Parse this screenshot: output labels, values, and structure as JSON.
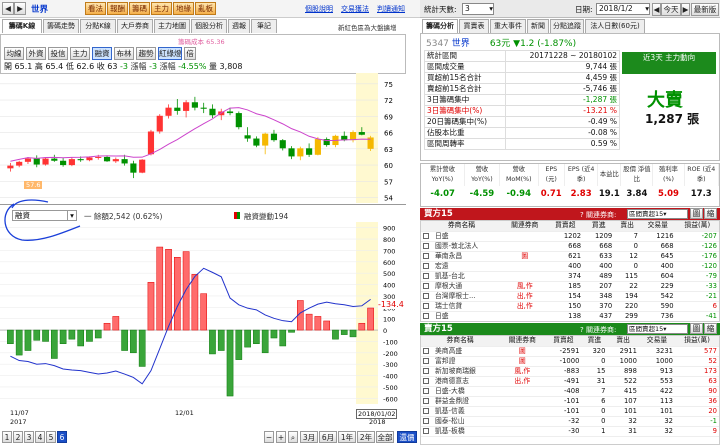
{
  "toolbar": {
    "back": "◀",
    "fwd": "▶",
    "market": "世界",
    "buttons": [
      "看法",
      "報酬",
      "籌碼",
      "主力",
      "地緣",
      "亂板"
    ],
    "links": [
      "個股說明",
      "交易獲法",
      "判讀通知"
    ]
  },
  "tabs": [
    "籌碼K線",
    "籌碼走勢",
    "分點K線",
    "大戶券商",
    "主力地圖",
    "個股分析",
    "週報",
    "筆記"
  ],
  "tabs_right_note": "新紅色區為大盤擴增",
  "chart_title": "籌碼成本 65.36",
  "indicator_buttons": [
    "均線",
    "外資",
    "投信",
    "主力",
    "融資",
    "布林",
    "趨勢",
    "紅綠燈",
    "倍"
  ],
  "ohlc": {
    "open": "開 65.1",
    "high": "高 65.4",
    "low": "低 62.6",
    "close": "收 63",
    "chg": "-3",
    "limit": "-3",
    "pct": "-4.55%",
    "vol": "量 3,808"
  },
  "price_axis": [
    "75",
    "72",
    "69",
    "66",
    "63",
    "60",
    "57",
    "54"
  ],
  "low_label": "57.6",
  "sub": {
    "select": "融資",
    "legend": "一 餘額2,542 (0.62%)",
    "legend2": "融資變動194",
    "neg_label": "-134.4"
  },
  "vol_axis": [
    "900",
    "800",
    "700",
    "600",
    "500",
    "400",
    "300",
    "200",
    "100",
    "0",
    "-100",
    "-200",
    "-300",
    "-400",
    "-500",
    "-600"
  ],
  "x_axis": {
    "d1": "11/07",
    "y1": "2017",
    "d2": "12/01",
    "d3": "2018/01/02",
    "y3": "2018"
  },
  "pager": {
    "pages": [
      "1",
      "2",
      "3",
      "4",
      "5",
      "6"
    ],
    "ranges": [
      "3月",
      "6月",
      "1年",
      "2年",
      "全部"
    ],
    "end": "還價",
    "cap": "◀"
  },
  "right_top": {
    "days_label": "統計天數:",
    "days": "3",
    "date_label": "日期:",
    "date": "2018/1/2",
    "today": "今天",
    "new": "最新版"
  },
  "rtabs": [
    "籌碼分析",
    "買賣表",
    "重大事件",
    "新聞",
    "分點追蹤",
    "法人日數(60元)"
  ],
  "stock": {
    "code": "5347",
    "name": "世界",
    "price": "63元",
    "chg": "▼1.2 (-1.87%)"
  },
  "stats": [
    {
      "k": "統計區間",
      "v": "20171228 ~ 20180102",
      "c": ""
    },
    {
      "k": "區間成交量",
      "v": "9,744 張",
      "c": ""
    },
    {
      "k": "買超前15名合計",
      "v": "4,459 張",
      "c": ""
    },
    {
      "k": "賣超前15名合計",
      "v": "-5,746 張",
      "c": ""
    },
    {
      "k": "3日籌碼集中",
      "v": "-1,287 張",
      "c": "green"
    },
    {
      "k": "3日籌碼集中(%)",
      "v": "-13.21 %",
      "c": "red"
    },
    {
      "k": "20日籌碼集中(%)",
      "v": "-0.49 %",
      "c": ""
    },
    {
      "k": "佔股本比重",
      "v": "-0.08 %",
      "c": ""
    },
    {
      "k": "區間周轉率",
      "v": "0.59 %",
      "c": ""
    }
  ],
  "trend": {
    "label": "近3天 主力動向",
    "big": "大賣",
    "vol": "1,287 張"
  },
  "summary": {
    "heads": [
      "累計營收 YoY(%)",
      "營收 YoY(%)",
      "營收 MoM(%)",
      "EPS (元)",
      "EPS (近4季)",
      "本益比",
      "股價 淨值比",
      "殖利率 (%)",
      "ROE (近4季)"
    ],
    "vals": [
      "-4.07",
      "-4.59",
      "-0.94",
      "0.71",
      "2.83",
      "19.1",
      "3.84",
      "5.09",
      "17.3"
    ]
  },
  "buy": {
    "title": "買方15",
    "related": "? 關連券商:",
    "sel": "區間賣超15",
    "btn1": "圖",
    "btn2": "縮",
    "cols": [
      "券商名稱",
      "關連券商",
      "買賣超",
      "買進",
      "賣出",
      "交易量",
      "損益(萬)"
    ],
    "rows": [
      [
        "日盛",
        "",
        "1202",
        "1209",
        "7",
        "1216",
        "-207"
      ],
      [
        "國票-敦北法人",
        "",
        "668",
        "668",
        "0",
        "668",
        "-126"
      ],
      [
        "華南永昌",
        "圖",
        "621",
        "633",
        "12",
        "645",
        "-176"
      ],
      [
        "宏遠",
        "",
        "400",
        "400",
        "0",
        "400",
        "-120"
      ],
      [
        "凱基-台北",
        "",
        "374",
        "489",
        "115",
        "604",
        "-79"
      ],
      [
        "摩根大通",
        "風,作",
        "185",
        "207",
        "22",
        "229",
        "-33"
      ],
      [
        "台灣摩根士...",
        "出,作",
        "154",
        "348",
        "194",
        "542",
        "-21"
      ],
      [
        "瑞士信貸",
        "出,作",
        "150",
        "370",
        "220",
        "590",
        "6"
      ],
      [
        "日盛",
        "",
        "138",
        "437",
        "299",
        "736",
        "-41"
      ]
    ]
  },
  "sell": {
    "title": "賣方15",
    "related": "? 關連券商:",
    "sel": "區間賣超15",
    "btn1": "圖",
    "btn2": "縮",
    "cols": [
      "券商名稱",
      "關連券商",
      "買賣超",
      "買進",
      "賣出",
      "交易量",
      "損益(萬)"
    ],
    "rows": [
      [
        "美商高盛",
        "圖",
        "-2591",
        "320",
        "2911",
        "3231",
        "577"
      ],
      [
        "富邦證",
        "圖",
        "-1000",
        "0",
        "1000",
        "1000",
        "52"
      ],
      [
        "新加坡商瑞銀",
        "風,作",
        "-883",
        "15",
        "898",
        "913",
        "173"
      ],
      [
        "港商德意志",
        "出,作",
        "-491",
        "31",
        "522",
        "553",
        "63"
      ],
      [
        "日盛-大橋",
        "",
        "-408",
        "7",
        "415",
        "422",
        "90"
      ],
      [
        "群益金鼎證",
        "",
        "-101",
        "6",
        "107",
        "113",
        "36"
      ],
      [
        "凱基-信義",
        "",
        "-101",
        "0",
        "101",
        "101",
        "20"
      ],
      [
        "國泰-松山",
        "",
        "-32",
        "0",
        "32",
        "32",
        "-1"
      ],
      [
        "凱基-板橋",
        "",
        "-30",
        "1",
        "31",
        "32",
        "9"
      ]
    ]
  },
  "chart_data": {
    "type": "candlestick",
    "price": {
      "ylim": [
        53,
        77
      ],
      "candles": [
        [
          59.4,
          60.4,
          58.8,
          59.9
        ],
        [
          59.9,
          60.8,
          59.6,
          60.6
        ],
        [
          60.6,
          61.5,
          60.2,
          61.2
        ],
        [
          61.2,
          61.8,
          59.6,
          60.1
        ],
        [
          60.1,
          61.4,
          59.9,
          61.2
        ],
        [
          61.2,
          61.9,
          60.6,
          60.8
        ],
        [
          60.8,
          61.3,
          59.7,
          60.0
        ],
        [
          60,
          61.4,
          59.8,
          61.1
        ],
        [
          61.1,
          61.6,
          60.6,
          60.9
        ],
        [
          60.9,
          61.6,
          60.7,
          61.4
        ],
        [
          61.4,
          61.9,
          61.0,
          61.5
        ],
        [
          61.5,
          61.8,
          60.6,
          60.7
        ],
        [
          60.7,
          61.4,
          60.4,
          61.1
        ],
        [
          61.1,
          61.9,
          59.9,
          60.3
        ],
        [
          60.3,
          60.8,
          57.6,
          58.6
        ],
        [
          58.6,
          61.1,
          58.5,
          61.0
        ],
        [
          62,
          66.5,
          61.8,
          66.2
        ],
        [
          66.2,
          69.4,
          65.8,
          69.1
        ],
        [
          69.1,
          71.2,
          68.6,
          70.6
        ],
        [
          70.6,
          72.2,
          69.3,
          70.0
        ],
        [
          70,
          72.0,
          68.8,
          71.6
        ],
        [
          71.6,
          72.6,
          70.1,
          70.6
        ],
        [
          70.6,
          71.5,
          69.6,
          70.4
        ],
        [
          70.4,
          71.2,
          68.7,
          69.2
        ],
        [
          69.2,
          70.4,
          68.3,
          69.9
        ],
        [
          69.9,
          70.6,
          69.2,
          69.6
        ],
        [
          69.6,
          69.9,
          66.6,
          67.0
        ],
        [
          65.5,
          67,
          64.3,
          64.9
        ],
        [
          64.9,
          65.3,
          63.3,
          63.6
        ],
        [
          63.6,
          66.0,
          62.0,
          65.8
        ],
        [
          65.8,
          66.5,
          64.3,
          64.6
        ],
        [
          64.6,
          64.8,
          62.7,
          63.1
        ],
        [
          63.1,
          63.5,
          61.1,
          61.6
        ],
        [
          61.6,
          63.4,
          60.9,
          63.1
        ],
        [
          63.1,
          64.0,
          61.5,
          61.9
        ],
        [
          61.9,
          65.2,
          61.8,
          64.8
        ],
        [
          64.8,
          65.1,
          63.4,
          63.7
        ],
        [
          63.7,
          65.6,
          63.3,
          65.4
        ],
        [
          65.4,
          66.2,
          64.4,
          64.6
        ],
        [
          64.6,
          66.4,
          64.2,
          66.1
        ],
        [
          66.1,
          67.0,
          65.5,
          65.6
        ],
        [
          65.1,
          65.4,
          62.6,
          63.0
        ]
      ]
    },
    "margin": {
      "ylim": [
        -650,
        950
      ],
      "values": [
        -120,
        -220,
        -180,
        -90,
        -100,
        -250,
        -120,
        -80,
        -140,
        -100,
        -70,
        60,
        120,
        -180,
        -200,
        -320,
        420,
        730,
        710,
        640,
        690,
        490,
        320,
        -210,
        -180,
        -580,
        -260,
        -150,
        -120,
        -200,
        -70,
        -140,
        -20,
        260,
        140,
        120,
        80,
        -80,
        -40,
        -60,
        60,
        194
      ],
      "line": [
        2680,
        2550,
        2520,
        2440,
        2460,
        2400,
        2300,
        2270,
        2250,
        2200,
        2150,
        2180,
        2240,
        2150,
        2050,
        1860,
        2250,
        2900,
        3560,
        4150,
        4650,
        5040,
        5280,
        5160,
        5030,
        4400,
        4200,
        4100,
        4050,
        3900,
        3800,
        3730,
        3700,
        3960,
        4100,
        4220,
        4280,
        4230,
        4200,
        4150,
        4170,
        4360
      ]
    }
  }
}
